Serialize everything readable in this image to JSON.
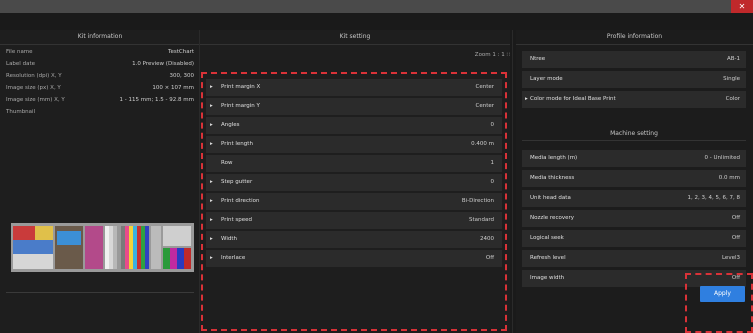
{
  "window": {
    "close_glyph": "✕",
    "accent": "#c0292b"
  },
  "left": {
    "title": "Kit information",
    "rows": [
      {
        "k": "File name",
        "v": "TestChart"
      },
      {
        "k": "Label date",
        "v": "1.0 Preview (Disabled)"
      },
      {
        "k": "Resolution (dpi) X, Y",
        "v": "300, 300"
      },
      {
        "k": "Image size (px) X, Y",
        "v": "100 × 107 mm"
      },
      {
        "k": "Image size (mm) X, Y",
        "v": "1 - 115 mm; 1.5 - 92.8 mm"
      },
      {
        "k": "Thumbnail",
        "v": ""
      }
    ],
    "btn1": "◂",
    "btn2": "▸"
  },
  "middle": {
    "title": "Kit setting",
    "zoom_label": "Zoom 1 : 1 ∷",
    "rows": [
      {
        "arrow": "▸",
        "label": "Print margin X",
        "value": "Center"
      },
      {
        "arrow": "▸",
        "label": "Print margin Y",
        "value": "Center"
      },
      {
        "arrow": "▸",
        "label": "Angles",
        "value": "0"
      },
      {
        "arrow": "▸",
        "label": "Print length",
        "value": "0.400 m"
      },
      {
        "arrow": "",
        "label": "Row",
        "value": "1"
      },
      {
        "arrow": "▸",
        "label": "Step gutter",
        "value": "0"
      },
      {
        "arrow": "▸",
        "label": "Print direction",
        "value": "Bi-Direction"
      },
      {
        "arrow": "▸",
        "label": "Print speed",
        "value": "Standard"
      },
      {
        "arrow": "▸",
        "label": "Width",
        "value": "2400"
      },
      {
        "arrow": "▸",
        "label": "Interlace",
        "value": "Off"
      }
    ]
  },
  "right": {
    "title": "Profile information",
    "top_rows": [
      {
        "arrow": "",
        "label": "Ntree",
        "value": "AB-1"
      },
      {
        "arrow": "",
        "label": "Layer mode",
        "value": "Single"
      },
      {
        "arrow": "▸",
        "label": "Color mode for Ideal Base Print",
        "value": "Color"
      }
    ],
    "section2_title": "Machine setting",
    "rows": [
      {
        "label": "Media length (m)",
        "value": "0 - Unlimited"
      },
      {
        "label": "Media thickness",
        "value": "0.0 mm"
      },
      {
        "label": "Unit head data",
        "value": "1, 2, 3, 4, 5, 6, 7, 8"
      },
      {
        "label": "Nozzle recovery",
        "value": "Off"
      },
      {
        "label": "Logical seek",
        "value": "Off"
      },
      {
        "label": "Refresh level",
        "value": "Level3"
      },
      {
        "label": "Image width",
        "value": "Off"
      }
    ]
  },
  "apply_label": "Apply"
}
